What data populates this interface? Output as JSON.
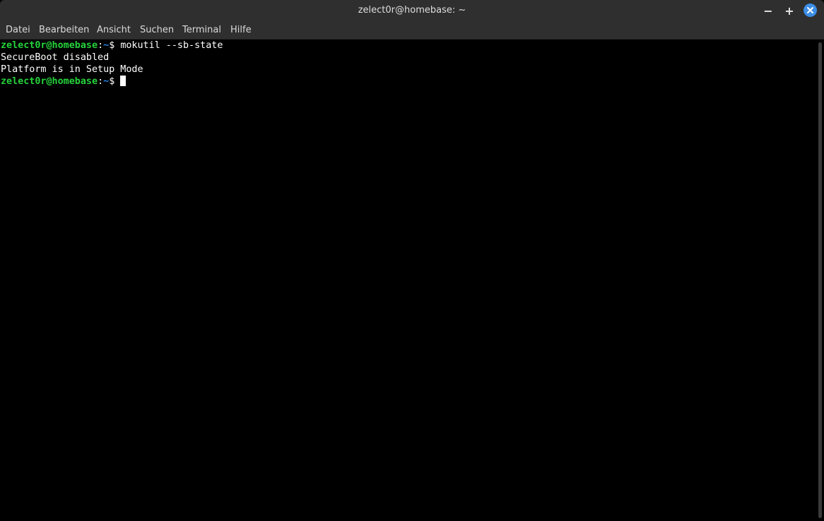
{
  "window": {
    "title": "zelect0r@homebase: ~",
    "buttons": {
      "minimize": "−",
      "maximize": "+",
      "close": "✕"
    }
  },
  "menubar": {
    "items": [
      {
        "label": "Datei"
      },
      {
        "label": "Bearbeiten"
      },
      {
        "label": "Ansicht"
      },
      {
        "label": "Suchen"
      },
      {
        "label": "Terminal"
      },
      {
        "label": "Hilfe"
      }
    ]
  },
  "terminal": {
    "lines": [
      {
        "user_host": "zelect0r@homebase",
        "sep": ":",
        "path": "~",
        "sigil": "$ ",
        "command": "mokutil --sb-state"
      },
      {
        "output": "SecureBoot disabled"
      },
      {
        "output": "Platform is in Setup Mode"
      },
      {
        "user_host": "zelect0r@homebase",
        "sep": ":",
        "path": "~",
        "sigil": "$ ",
        "command": ""
      }
    ]
  },
  "colors": {
    "prompt_user": "#26d23c",
    "prompt_path": "#2b84e6",
    "background": "#000000",
    "close_button": "#3d8ee6"
  }
}
